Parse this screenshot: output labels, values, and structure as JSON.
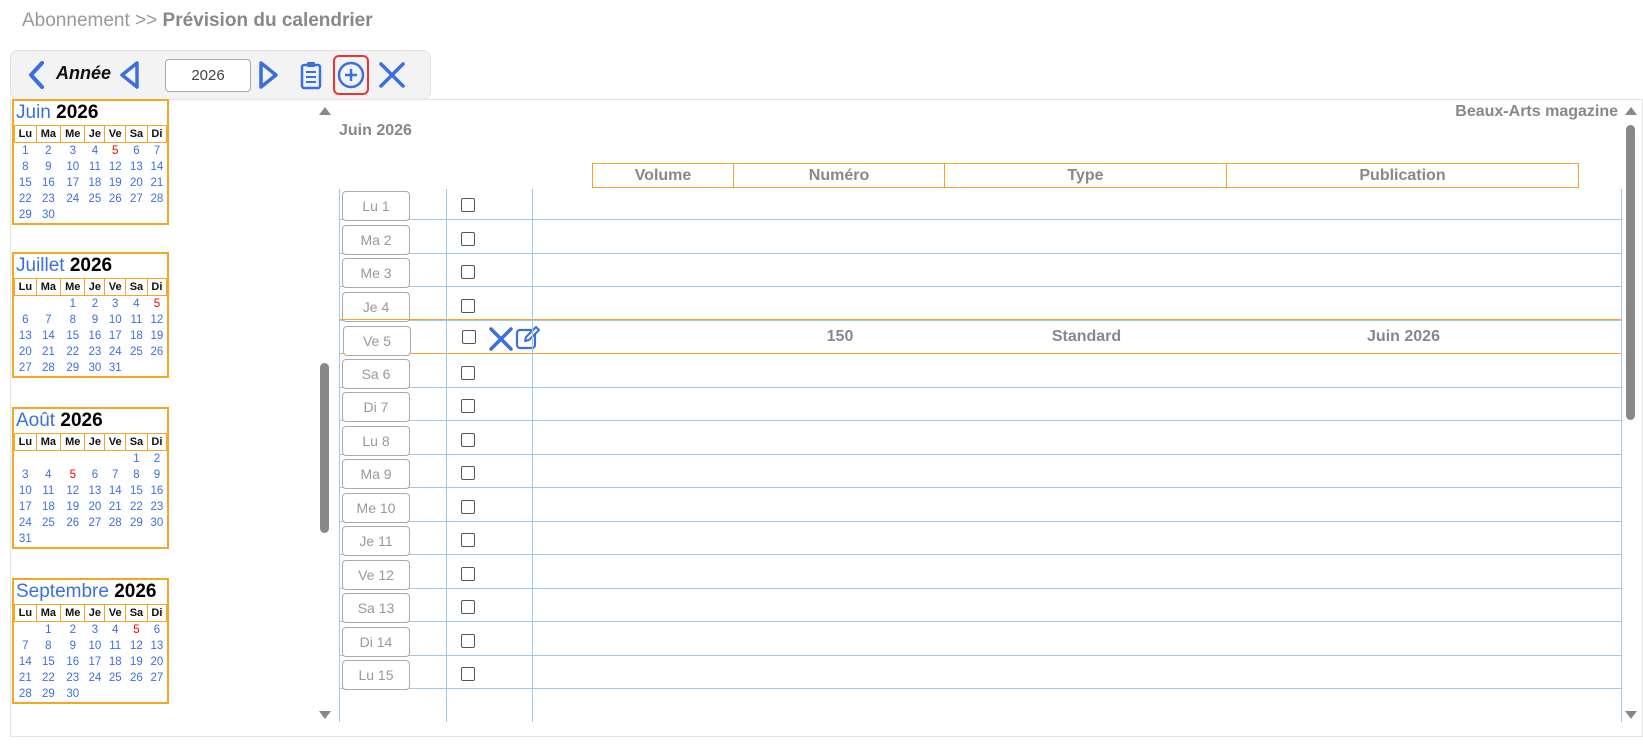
{
  "breadcrumb": {
    "parent": "Abonnement",
    "separator": ">>",
    "current": "Prévision du calendrier"
  },
  "toolbar": {
    "year_label": "Année",
    "year_value": "2026",
    "icons": [
      "chevron-left-icon",
      "triangle-left-icon",
      "triangle-right-icon",
      "clipboard-icon",
      "add-circle-icon",
      "close-icon"
    ],
    "accent_color": "#3b6fe0",
    "highlight_color": "#e33333"
  },
  "mini_calendars": [
    {
      "month": "Juin",
      "year": "2026",
      "headers": [
        "Lu",
        "Ma",
        "Me",
        "Je",
        "Ve",
        "Sa",
        "Di"
      ],
      "weeks": [
        [
          "1",
          "2",
          "3",
          "4",
          "5",
          "6",
          "7"
        ],
        [
          "8",
          "9",
          "10",
          "11",
          "12",
          "13",
          "14"
        ],
        [
          "15",
          "16",
          "17",
          "18",
          "19",
          "20",
          "21"
        ],
        [
          "22",
          "23",
          "24",
          "25",
          "26",
          "27",
          "28"
        ],
        [
          "29",
          "30",
          "",
          "",
          "",
          "",
          ""
        ]
      ],
      "highlight": "5"
    },
    {
      "month": "Juillet",
      "year": "2026",
      "headers": [
        "Lu",
        "Ma",
        "Me",
        "Je",
        "Ve",
        "Sa",
        "Di"
      ],
      "weeks": [
        [
          "",
          "",
          "1",
          "2",
          "3",
          "4",
          "5"
        ],
        [
          "6",
          "7",
          "8",
          "9",
          "10",
          "11",
          "12"
        ],
        [
          "13",
          "14",
          "15",
          "16",
          "17",
          "18",
          "19"
        ],
        [
          "20",
          "21",
          "22",
          "23",
          "24",
          "25",
          "26"
        ],
        [
          "27",
          "28",
          "29",
          "30",
          "31",
          "",
          ""
        ]
      ],
      "highlight": "5"
    },
    {
      "month": "Août",
      "year": "2026",
      "headers": [
        "Lu",
        "Ma",
        "Me",
        "Je",
        "Ve",
        "Sa",
        "Di"
      ],
      "weeks": [
        [
          "",
          "",
          "",
          "",
          "",
          "1",
          "2"
        ],
        [
          "3",
          "4",
          "5",
          "6",
          "7",
          "8",
          "9"
        ],
        [
          "10",
          "11",
          "12",
          "13",
          "14",
          "15",
          "16"
        ],
        [
          "17",
          "18",
          "19",
          "20",
          "21",
          "22",
          "23"
        ],
        [
          "24",
          "25",
          "26",
          "27",
          "28",
          "29",
          "30"
        ],
        [
          "31",
          "",
          "",
          "",
          "",
          "",
          ""
        ]
      ],
      "highlight": "5"
    },
    {
      "month": "Septembre",
      "year": "2026",
      "headers": [
        "Lu",
        "Ma",
        "Me",
        "Je",
        "Ve",
        "Sa",
        "Di"
      ],
      "weeks": [
        [
          "",
          "1",
          "2",
          "3",
          "4",
          "5",
          "6"
        ],
        [
          "7",
          "8",
          "9",
          "10",
          "11",
          "12",
          "13"
        ],
        [
          "14",
          "15",
          "16",
          "17",
          "18",
          "19",
          "20"
        ],
        [
          "21",
          "22",
          "23",
          "24",
          "25",
          "26",
          "27"
        ],
        [
          "28",
          "29",
          "30",
          "",
          "",
          "",
          ""
        ]
      ],
      "highlight": "5"
    }
  ],
  "main": {
    "month_title": "Juin 2026",
    "magazine": "Beaux-Arts magazine",
    "columns": [
      "Volume",
      "Numéro",
      "Type",
      "Publication"
    ],
    "days": [
      "Lu 1",
      "Ma 2",
      "Me 3",
      "Je 4",
      "Ve 5",
      "Sa 6",
      "Di 7",
      "Lu 8",
      "Ma 9",
      "Me 10",
      "Je 11",
      "Ve 12",
      "Sa 13",
      "Di 14",
      "Lu 15"
    ],
    "entry": {
      "day": "Ve 5",
      "volume": "",
      "numero": "150",
      "type": "Standard",
      "publication": "Juin 2026"
    }
  }
}
